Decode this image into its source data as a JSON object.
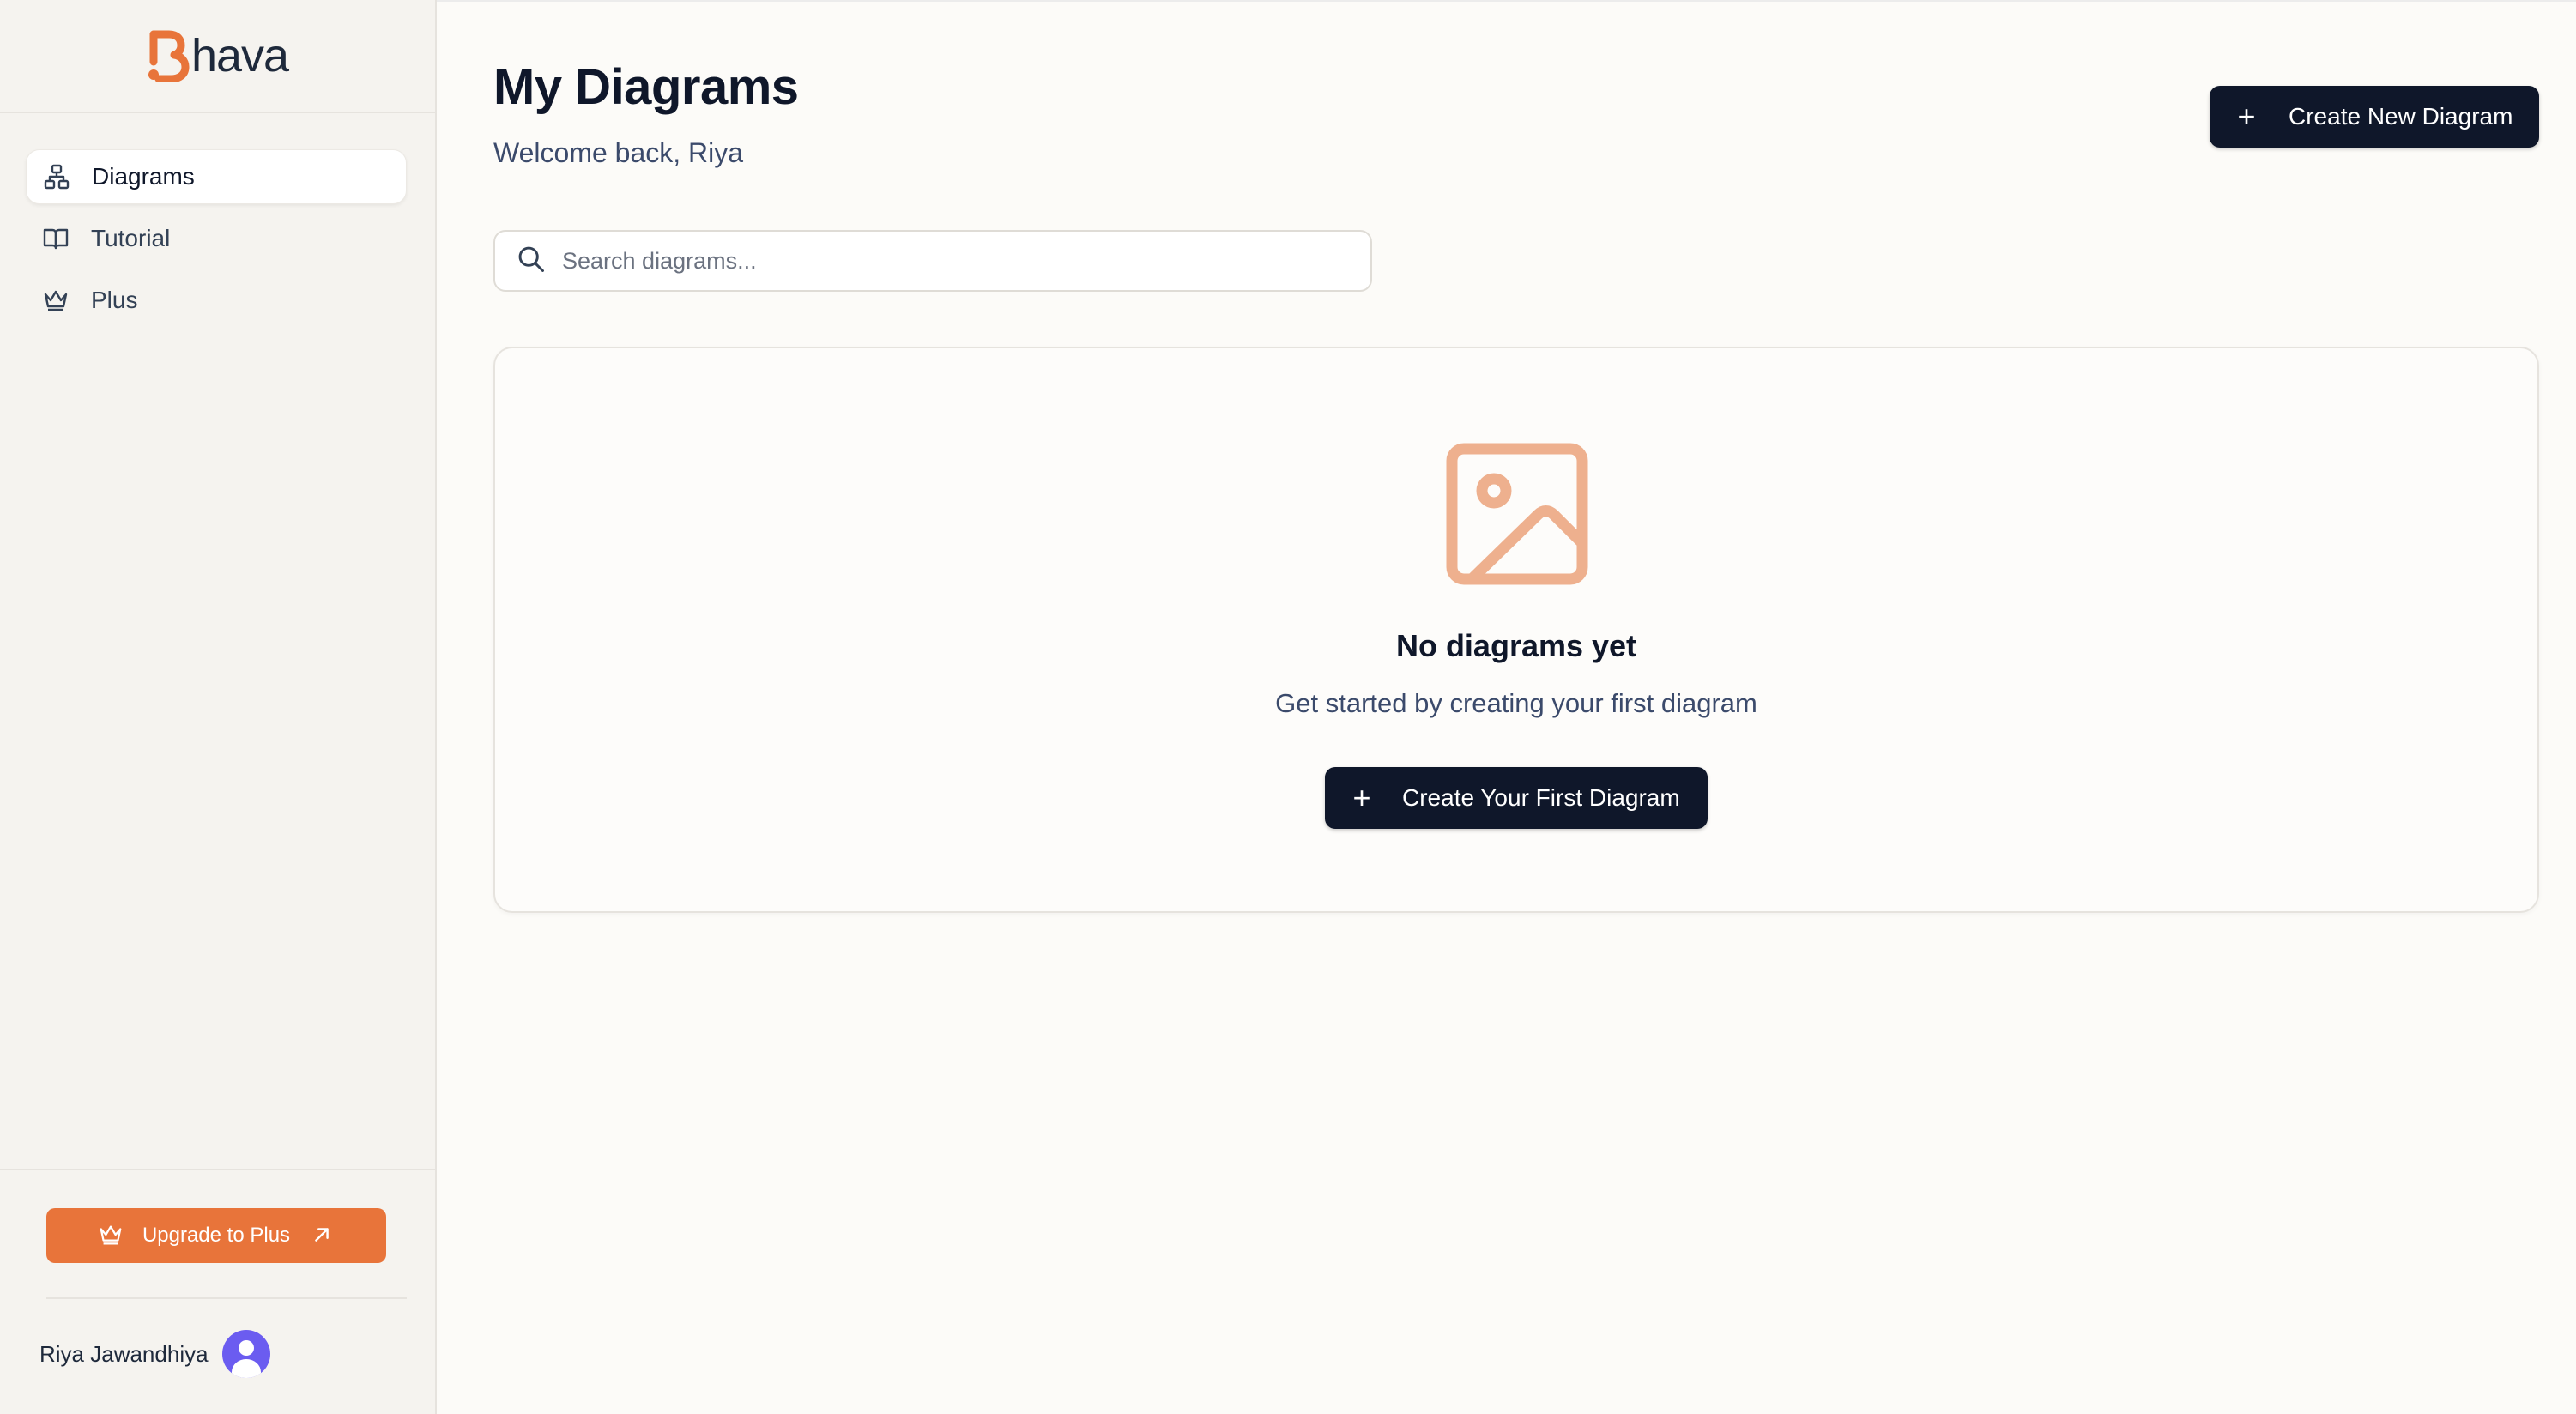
{
  "brand": {
    "name": "hava",
    "accent_color": "#e8743a",
    "logo_icon": "bhava-b-logo"
  },
  "sidebar": {
    "items": [
      {
        "label": "Diagrams",
        "icon": "diagram-tree-icon",
        "active": true
      },
      {
        "label": "Tutorial",
        "icon": "book-open-icon",
        "active": false
      },
      {
        "label": "Plus",
        "icon": "crown-icon",
        "active": false
      }
    ],
    "upgrade": {
      "label": "Upgrade to Plus",
      "icon": "crown-icon",
      "trailing_icon": "arrow-up-right-icon",
      "color": "#e8743a"
    },
    "user": {
      "name": "Riya Jawandhiya",
      "avatar_color": "#6b5cf0"
    }
  },
  "main": {
    "title": "My Diagrams",
    "subtitle": "Welcome back, Riya",
    "create_new": {
      "plus": "+",
      "label": "Create New Diagram"
    },
    "search": {
      "placeholder": "Search diagrams...",
      "value": ""
    },
    "empty_state": {
      "icon": "image-icon",
      "icon_color": "#eeb08e",
      "title": "No diagrams yet",
      "description": "Get started by creating your first diagram",
      "button": {
        "plus": "+",
        "label": "Create Your First Diagram"
      }
    }
  }
}
